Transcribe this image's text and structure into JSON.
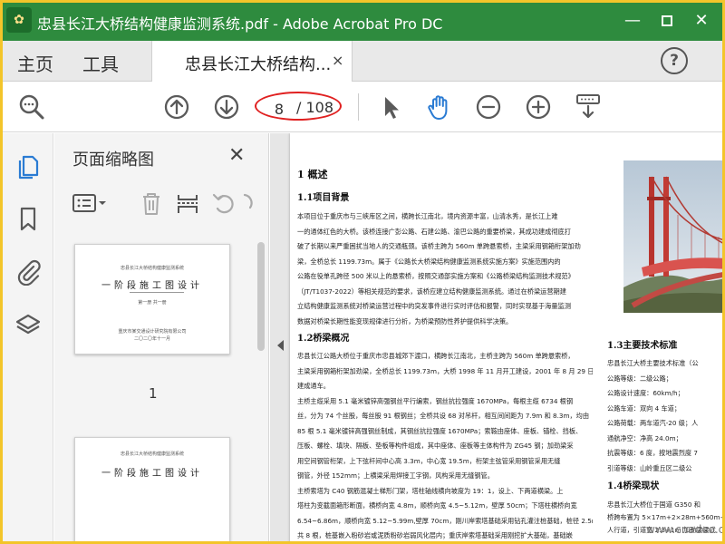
{
  "window": {
    "title": "忠县长江大桥结构健康监测系统.pdf - Adobe Acrobat Pro DC",
    "minimize": "—",
    "close": "✕"
  },
  "menu": {
    "home": "主页",
    "tools": "工具",
    "doc_tab": "忠县长江大桥结构...",
    "doc_tab_close": "×",
    "help": "?"
  },
  "toolbar": {
    "current_page": "8",
    "total_pages": "/ 108"
  },
  "thumbnail_panel": {
    "title": "页面缩略图",
    "close": "✕",
    "page1_number": "1",
    "thumb1": {
      "top_text": "忠县长江大桥结构健康监测系统",
      "big_text": "一阶段施工图设计",
      "sub": "第一册 共一册",
      "footer": "重庆市某交通设计研究院有限公司",
      "date": "二〇二〇年十一月"
    },
    "thumb2": {
      "top_text": "忠县长江大桥结构健康监测系统",
      "big_text": "一阶段施工图设计"
    }
  },
  "document": {
    "h_overview": "1  概述",
    "h_background": "1.1项目背景",
    "p_background": [
      "本项目位于重庆市与三峡库区之间，横跨长江南北，境内资源丰富，山清水秀，是长江上难",
      "一的通体红色的大桥。该桥连接广彭公路、石建公路、渝巴公路的重要桥梁，其成功建成彻底打",
      "破了长期以来严重困扰当地人的交通瓶颈。该桥主跨为 560m 单跨悬索桥，主梁采用钢箱桁架加劲",
      "梁，全桥总长 1199.73m。属于《公路长大桥梁结构健康监测系统实施方案》实施范围内的",
      "公路在役单孔跨径 500 米以上的悬索桥，按照交通部实施方案和《公路桥梁结构监测技术规范》",
      "（JT/T1037-2022）等相关规范的要求，该桥应建立结构健康监测系统。通过在桥梁运营期建",
      "立结构健康监测系统对桥梁运营过程中的突发事件进行实时评估和报警，同时实现基于海量监测",
      "数据对桥梁长期性能变现规律进行分析，为桥梁预防性养护提供科学决策。"
    ],
    "h_bridge": "1.2桥梁概况",
    "p_bridge": [
      "忠县长江公路大桥位于重庆市忠县城郊下渡口，横跨长江南北，主桥主跨为 560m 单跨悬索桥，",
      "主梁采用钢箱桁架加劲梁，全桥总长 1199.73m，大桥 1998 年 11 月开工建设，2001 年 8 月 29 日",
      "建成通车。",
      "主桥主缆采用 5.1 毫米镀锌高强钢丝平行编索，钢丝抗拉强度 1670MPa，每根主缆 6734 根钢",
      "丝，分为 74 个丝股，每丝股 91 根钢丝；全桥共设 68 对吊杆，相互间间距为 7.9m 和 8.3m，均由",
      "85 根 5.1 毫米镀锌高强钢丝制成，其钢丝抗拉强度 1670MPa；索鞍由座体、座板、锚栓、挡板、",
      "压板、螺栓、填块、隔板、垫板等构件组成，其中座体、座板等主体构件为 ZG45 钢；加劲梁采",
      "用空间钢管桁架，上下弦杆间中心高 3.3m，中心宽 19.5m，桁架主弦管采用钢管采用无缝",
      "钢管，外径 152mm；上横梁采用焊接工字钢，风构采用无缝钢管。",
      "主桥索塔为 C40 钢筋混凝土梯形门架，塔柱轴线横向坡度为 19：1，设上、下两道横梁。上",
      "塔柱为变截面箱形断面，横桥向宽 4.8m，顺桥向宽 4.5~5.12m，壁厚 50cm；下塔柱横桥向宽",
      "6.54~6.86m，顺桥向宽 5.12~5.99m,壁厚 70cm，刚川岸索塔基础采用钻孔灌注桩基础，桩径 2.5m,",
      "共 8 根，桩基嵌入粉砂岩或泥质粉砂岩弱风化层内；重庆岸索塔基础采用刚挖扩大基础，基础嵌",
      "入基岩弱风化层中的深度不小于 5m，且基底持力层不存在软弱层，其上下游塔柱基础均为 3.0MPa"
    ],
    "h_tech": "1.3主要技术标准",
    "p_tech": [
      "忠县长江大桥主要技术标准（公",
      "公路等级：二级公路；",
      "公路设计速度：60km/h；",
      "公路车道：双向 4 车道；",
      "公路荷载：两车道汽-20 级；人",
      "通航净空：净高 24.0m；",
      "抗震等级：6 度，按地震烈度 7",
      "引道等级：山岭重丘区二级公"
    ],
    "h_status": "1.4桥梁现状",
    "p_status": [
      "忠县长江大桥位于国道 G350 和",
      "桥跨布置为 5×17m+2×28m+560m+",
      "人行道，引道宽 2.3+1m 加劲梁梁式"
    ]
  },
  "watermark": "www.cnadeo.com",
  "colors": {
    "titlebar": "#2e8b3e",
    "annotation_red": "#e02020",
    "frame_yellow": "#f3c52a",
    "icon_gray": "#5a5a5a"
  }
}
